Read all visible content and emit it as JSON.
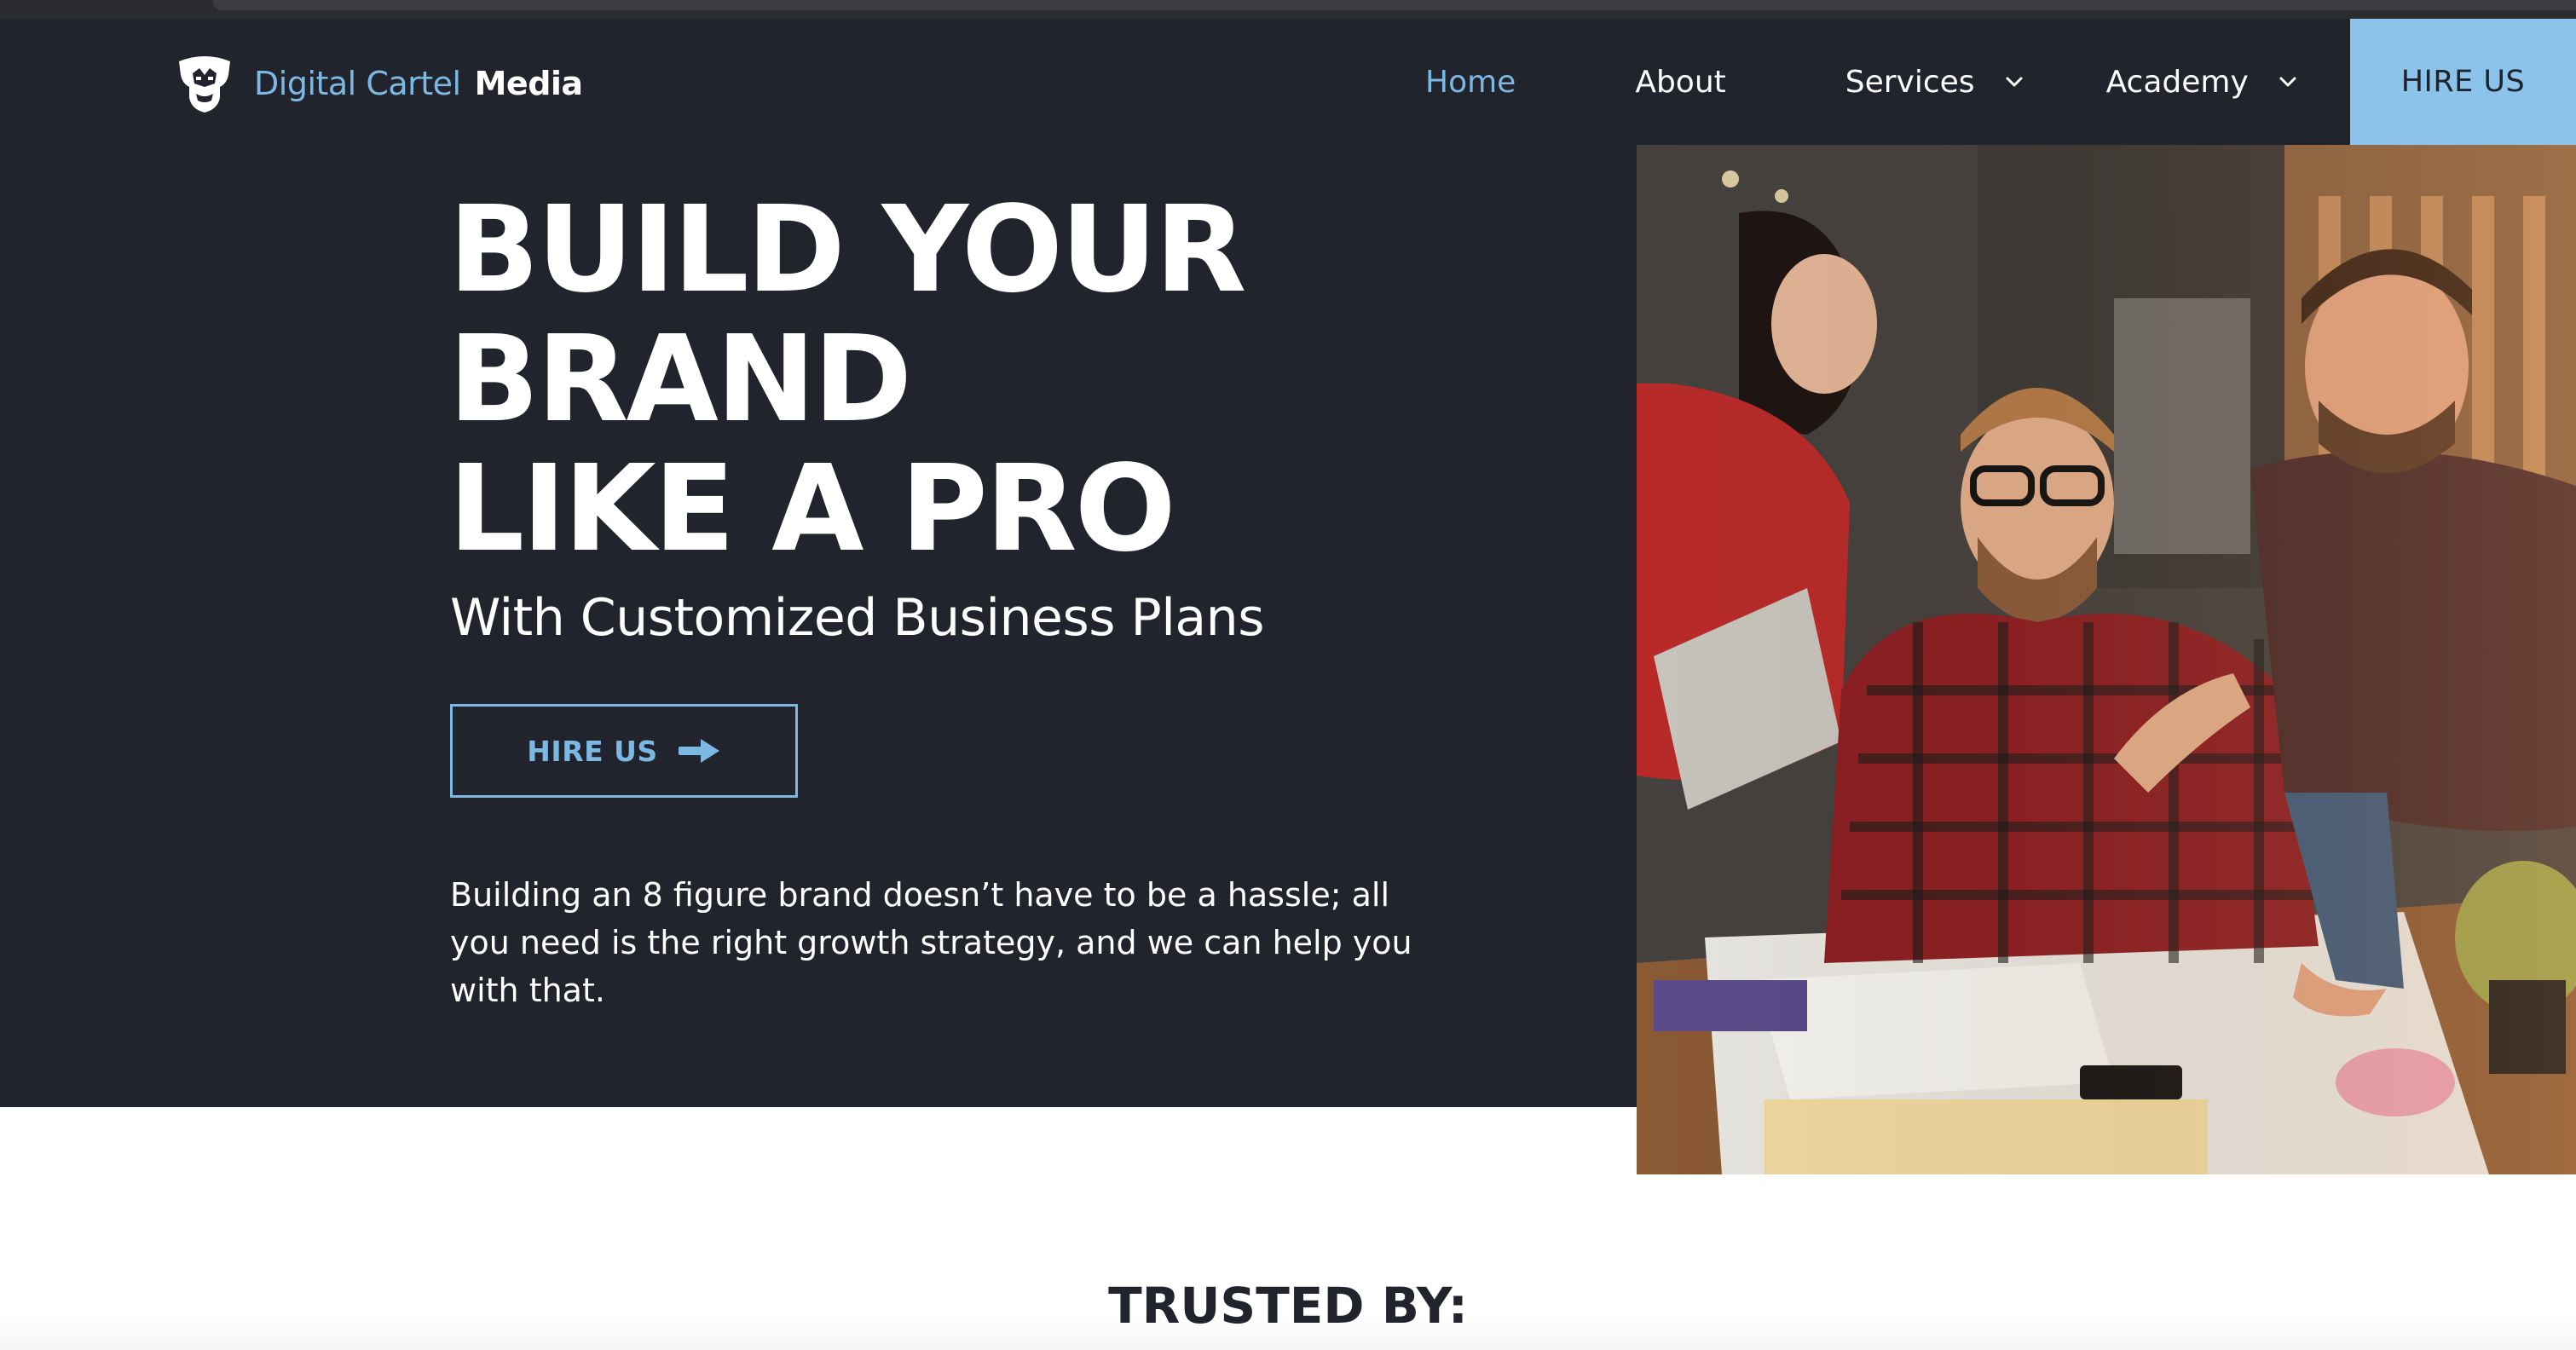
{
  "brand": {
    "name_part1": "Digital Cartel",
    "name_part2": "Media",
    "logo_icon": "gorilla-mask-logo-icon"
  },
  "nav": {
    "items": [
      {
        "label": "Home",
        "active": true,
        "has_dropdown": false
      },
      {
        "label": "About",
        "active": false,
        "has_dropdown": false
      },
      {
        "label": "Services",
        "active": false,
        "has_dropdown": true
      },
      {
        "label": "Academy",
        "active": false,
        "has_dropdown": true
      }
    ],
    "cta_label": "HIRE US"
  },
  "hero": {
    "title_lines": [
      "BUILD YOUR",
      "BRAND",
      "LIKE A PRO"
    ],
    "subtitle": "With Customized Business Plans",
    "button_label": "HIRE US",
    "button_icon": "arrow-right-icon",
    "body": "Building an 8 figure brand doesn’t have to be a hassle; all you need is the right growth strategy, and we can help you with that."
  },
  "trusted": {
    "heading": "TRUSTED BY:"
  },
  "colors": {
    "hero_background": "#21242c",
    "accent": "#7db8e3",
    "cta_background": "#8cc3ea",
    "text_light": "#ffffff",
    "text_dark": "#21242c"
  }
}
